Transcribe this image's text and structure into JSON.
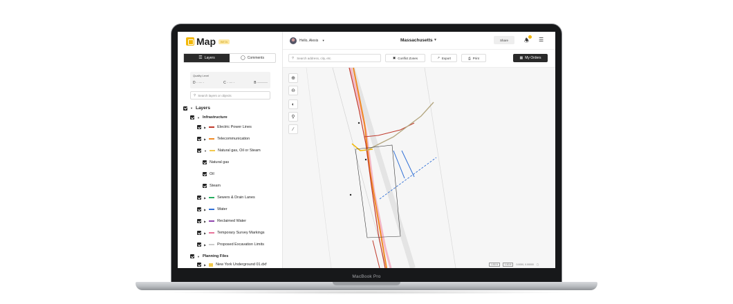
{
  "device": {
    "label": "MacBook Pro"
  },
  "app": {
    "logo_text": "Map",
    "beta_badge": "BETA"
  },
  "sidebar": {
    "tabs": [
      {
        "label": "Layers",
        "icon": "layers-icon",
        "active": true
      },
      {
        "label": "Comments",
        "icon": "comment-icon",
        "active": false
      }
    ],
    "quality": {
      "label": "Quality Level",
      "levels": [
        "D",
        "C",
        "B"
      ]
    },
    "search_placeholder": "Search layers or objects",
    "tree": {
      "root_label": "Layers",
      "infrastructure_label": "Infrastructure",
      "layers": [
        {
          "label": "Electric Power Lines",
          "color": "#c0392b"
        },
        {
          "label": "Telecommunication",
          "color": "#f08a24"
        },
        {
          "label": "Natural gas, Oil or Steam",
          "color": "#f2c94c"
        },
        {
          "label": "Natural gas",
          "color": ""
        },
        {
          "label": "Oil",
          "color": ""
        },
        {
          "label": "Steam",
          "color": ""
        },
        {
          "label": "Sewers & Drain Lanes",
          "color": "#27ae60"
        },
        {
          "label": "Water",
          "color": "#2f6fd6"
        },
        {
          "label": "Reclaimed Water",
          "color": "#8e44ad"
        },
        {
          "label": "Temporary Survey Markings",
          "color": "#e8739a"
        },
        {
          "label": "Proposed Excavation Limits",
          "color": "#ffffff"
        }
      ],
      "planning_label": "Planning Files",
      "planning_items": [
        {
          "label": "New York Underground 01.dxf",
          "color": "#f2c94c"
        }
      ]
    }
  },
  "topbar": {
    "greeting": "Hello, Alexis",
    "region": "Massachusetts",
    "share_label": "Share"
  },
  "toolbar": {
    "search_placeholder": "Search address, city, etc.",
    "conflict_label": "Conflict Zones",
    "export_label": "Export",
    "print_label": "Print",
    "orders_label": "My Orders"
  },
  "map": {
    "controls": [
      "zoom-in-icon",
      "zoom-out-icon",
      "layers-toggle-icon",
      "location-pin-icon",
      "ruler-icon"
    ],
    "scale_labels": [
      "1:50 ft",
      "1:50 ft"
    ],
    "zoom_readout": "0.0000, 0.00000"
  },
  "colors": {
    "accent": "#f2b705",
    "dark": "#2a2a2a",
    "electric": "#c0392b",
    "telecom": "#f08a24",
    "water": "#2f6fd6",
    "sewer": "#8c9a5b"
  }
}
